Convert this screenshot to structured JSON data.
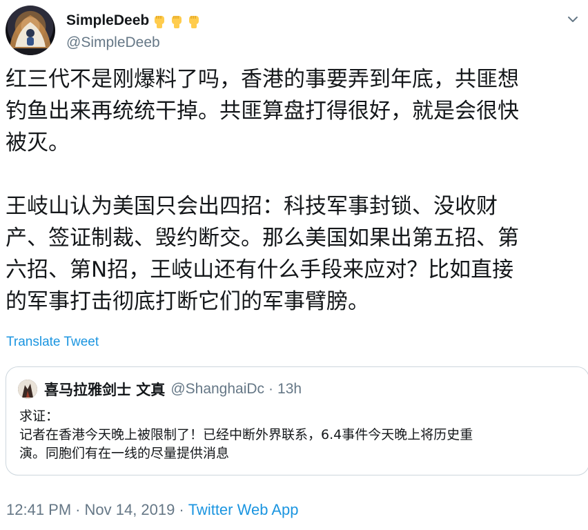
{
  "author": {
    "display_name": "SimpleDeeb",
    "handle": "@SimpleDeeb",
    "name_emojis": [
      "raised-fist-emoji",
      "raised-fist-emoji",
      "raised-fist-emoji"
    ]
  },
  "tweet": {
    "text": "红三代不是刚爆料了吗，香港的事要弄到年底，共匪想\n钓鱼出来再统统干掉。共匪算盘打得很好，就是会很快\n被灭。\n\n王岐山认为美国只会出四招：科技军事封锁、没收财\n产、签证制裁、毁约断交。那么美国如果出第五招、第\n六招、第N招，王岐山还有什么手段来应对？比如直接\n的军事打击彻底打断它们的军事臂膀。",
    "translate_label": "Translate Tweet"
  },
  "quoted": {
    "display_name": "喜马拉雅剑士 文真",
    "handle": "@ShanghaiDc",
    "separator": "·",
    "time": "13h",
    "text": "求证：\n记者在香港今天晚上被限制了！已经中断外界联系，6.4事件今天晚上将历史重\n演。同胞们有在一线的尽量提供消息"
  },
  "meta": {
    "time": "12:41 PM",
    "separator": "·",
    "date": "Nov 14, 2019",
    "source": "Twitter Web App"
  },
  "colors": {
    "link": "#1b95e0",
    "secondary_text": "#657786",
    "primary_text": "#14171a",
    "border": "#ccd6dd"
  }
}
